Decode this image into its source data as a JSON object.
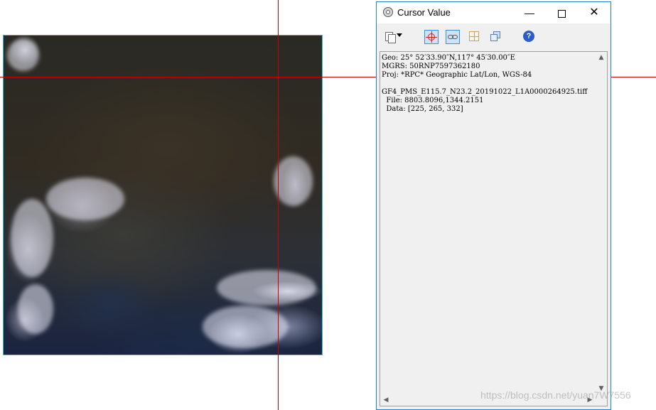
{
  "window": {
    "title": "Cursor Value",
    "minimize_glyph": "—",
    "close_glyph": "✕"
  },
  "toolbar": {
    "copy_icon": "copy-icon",
    "crosshair_icon": "crosshair-icon",
    "link_icon": "link-icon",
    "grid_icon": "grid-icon",
    "stack_icon": "stack-icon",
    "help_icon": "help-icon",
    "help_glyph": "?"
  },
  "cursor_info": {
    "geo": "Geo: 25° 52′33.90″N,117° 45′30.00″E",
    "mgrs": "MGRS: 50RNP7597362180",
    "proj": "Proj: *RPC* Geographic Lat/Lon, WGS-84",
    "file_name": "GF4_PMS_E115.7_N23.2_20191022_L1A0000264925.tiff",
    "file_coords": "  File: 8803.8096,1344.2151",
    "data_values": "  Data: [225, 265, 332]"
  },
  "scroll": {
    "up": "▲",
    "down": "▼",
    "left": "◀",
    "right": "▶"
  },
  "watermark": "https://blog.csdn.net/yuan7W7556",
  "colors": {
    "crosshair": "#cc0000",
    "image_border": "#35c4c9",
    "dialog_border": "#1c84d8"
  }
}
